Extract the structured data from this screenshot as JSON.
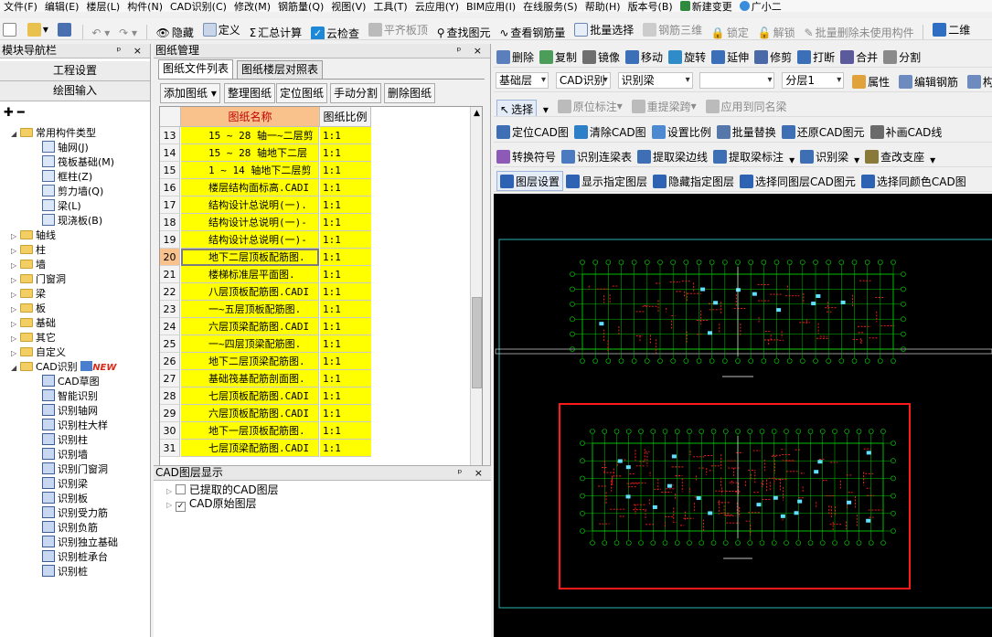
{
  "menubar": [
    "文件(F)",
    "编辑(E)",
    "楼层(L)",
    "构件(N)",
    "CAD识别(C)",
    "修改(M)",
    "钢筋量(Q)",
    "视图(V)",
    "工具(T)",
    "云应用(Y)",
    "BIM应用(I)",
    "在线服务(S)",
    "帮助(H)",
    "版本号(B)",
    "新建变更",
    "广小二"
  ],
  "toolbar": {
    "hide": "隐藏",
    "define": "定义",
    "calc_all": "汇总计算",
    "cloud_check": "云检查",
    "flat_slab": "平齐板顶",
    "find_elem": "查找图元",
    "view_rebar": "查看钢筋量",
    "batch_select": "批量选择",
    "rebar_3d": "钢筋三维",
    "lock": "锁定",
    "unlock": "解锁",
    "batch_delete_unused": "批量删除未使用构件",
    "two_d": "二维"
  },
  "left_panel": {
    "title": "模块导航栏",
    "nav1": "工程设置",
    "nav2": "绘图输入",
    "root": "常用构件类型",
    "common_items": [
      "轴网(J)",
      "筏板基础(M)",
      "框柱(Z)",
      "剪力墙(Q)",
      "梁(L)",
      "现浇板(B)"
    ],
    "folders": [
      "轴线",
      "柱",
      "墙",
      "门窗洞",
      "梁",
      "板",
      "基础",
      "其它",
      "自定义"
    ],
    "cad_folder": "CAD识别",
    "new_badge": "NEW",
    "cad_items": [
      "CAD草图",
      "智能识别",
      "识别轴网",
      "识别柱大样",
      "识别柱",
      "识别墙",
      "识别门窗洞",
      "识别梁",
      "识别板",
      "识别受力筋",
      "识别负筋",
      "识别独立基础",
      "识别桩承台",
      "识别桩"
    ]
  },
  "mid_panel": {
    "title": "图纸管理",
    "tab1": "图纸文件列表",
    "tab2": "图纸楼层对照表",
    "buttons": [
      "添加图纸",
      "整理图纸",
      "定位图纸",
      "手动分割",
      "删除图纸"
    ],
    "col_name": "图纸名称",
    "col_scale": "图纸比例",
    "rows": [
      {
        "no": "13",
        "name": "15 ~ 28 轴一~二层剪",
        "scale": "1:1"
      },
      {
        "no": "14",
        "name": "15 ~ 28 轴地下二层",
        "scale": "1:1"
      },
      {
        "no": "15",
        "name": "1 ~ 14 轴地下二层剪",
        "scale": "1:1"
      },
      {
        "no": "16",
        "name": "楼层结构面标高.CADI",
        "scale": "1:1"
      },
      {
        "no": "17",
        "name": "结构设计总说明(一).",
        "scale": "1:1"
      },
      {
        "no": "18",
        "name": "结构设计总说明(一)-",
        "scale": "1:1"
      },
      {
        "no": "19",
        "name": "结构设计总说明(一)-",
        "scale": "1:1"
      },
      {
        "no": "20",
        "name": "地下二层顶板配筋图.",
        "scale": "1:1"
      },
      {
        "no": "21",
        "name": "楼梯标准层平面图.",
        "scale": "1:1"
      },
      {
        "no": "22",
        "name": "八层顶板配筋图.CADI",
        "scale": "1:1"
      },
      {
        "no": "23",
        "name": "一~五层顶板配筋图.",
        "scale": "1:1"
      },
      {
        "no": "24",
        "name": "六层顶梁配筋图.CADI",
        "scale": "1:1"
      },
      {
        "no": "25",
        "name": "一~四层顶梁配筋图.",
        "scale": "1:1"
      },
      {
        "no": "26",
        "name": "地下二层顶梁配筋图.",
        "scale": "1:1"
      },
      {
        "no": "27",
        "name": "基础筏基配筋剖面图.",
        "scale": "1:1"
      },
      {
        "no": "28",
        "name": "七层顶板配筋图.CADI",
        "scale": "1:1"
      },
      {
        "no": "29",
        "name": "六层顶板配筋图.CADI",
        "scale": "1:1"
      },
      {
        "no": "30",
        "name": "地下一层顶板配筋图.",
        "scale": "1:1"
      },
      {
        "no": "31",
        "name": "七层顶梁配筋图.CADI",
        "scale": "1:1"
      }
    ],
    "layer_title": "CAD图层显示",
    "layer_items": [
      "已提取的CAD图层",
      "CAD原始图层"
    ]
  },
  "right_panel": {
    "row1": [
      "删除",
      "复制",
      "镜像",
      "移动",
      "旋转",
      "延伸",
      "修剪",
      "打断",
      "合并",
      "分割"
    ],
    "row2_dropdowns": [
      "基础层",
      "CAD识别",
      "识别梁",
      "",
      "分层1"
    ],
    "row2_buttons": [
      "属性",
      "编辑钢筋",
      "构件列"
    ],
    "row3": [
      "选择",
      "原位标注",
      "重提梁跨",
      "应用到同名梁"
    ],
    "row4": [
      "定位CAD图",
      "清除CAD图",
      "设置比例",
      "批量替换",
      "还原CAD图元",
      "补画CAD线"
    ],
    "row5": [
      "转换符号",
      "识别连梁表",
      "提取梁边线",
      "提取梁标注",
      "识别梁",
      "查改支座"
    ],
    "row6": [
      "图层设置",
      "显示指定图层",
      "隐藏指定图层",
      "选择同图层CAD图元",
      "选择同颜色CAD图"
    ]
  }
}
